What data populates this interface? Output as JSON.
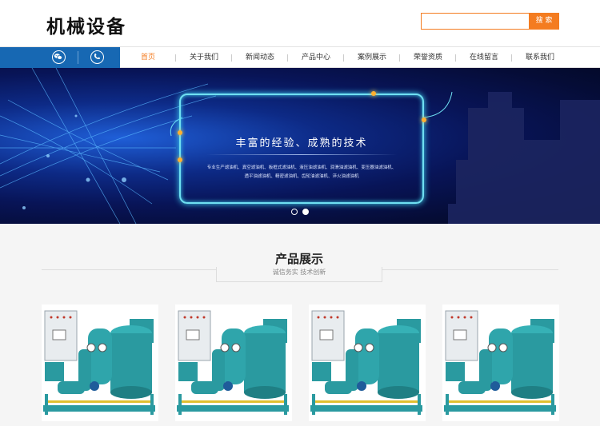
{
  "header": {
    "logo": "机械设备",
    "search": {
      "placeholder": "",
      "button_label": "搜 索"
    }
  },
  "contact": {
    "icons": [
      "wechat-icon",
      "phone-icon"
    ],
    "color": "#1768b3"
  },
  "nav": {
    "items": [
      {
        "label": "首页",
        "active": true
      },
      {
        "label": "关于我们"
      },
      {
        "label": "新闻动态"
      },
      {
        "label": "产品中心"
      },
      {
        "label": "案例展示"
      },
      {
        "label": "荣誉资质"
      },
      {
        "label": "在线留言"
      },
      {
        "label": "联系我们"
      }
    ],
    "active_color": "#f47c20"
  },
  "banner": {
    "title": "丰富的经验、成熟的技术",
    "text_line1": "专业生产滤油机、真空滤油机、板框式滤油机、液压油滤油机、润滑油滤油机、变压器油滤油机、",
    "text_line2": "透平油滤油机、精密滤油机、齿轮油滤油机、淬火油滤油机",
    "slide_count": 2,
    "active_slide": 2
  },
  "products_section": {
    "title": "产品展示",
    "subtitle": "诚信务实 技术创新",
    "products": [
      {
        "image": "oil-filter-machine"
      },
      {
        "image": "oil-filter-machine"
      },
      {
        "image": "oil-filter-machine"
      },
      {
        "image": "oil-filter-machine"
      }
    ]
  },
  "colors": {
    "accent": "#f47c20",
    "brand_blue": "#1768b3",
    "machine_teal": "#2a9aa0"
  }
}
